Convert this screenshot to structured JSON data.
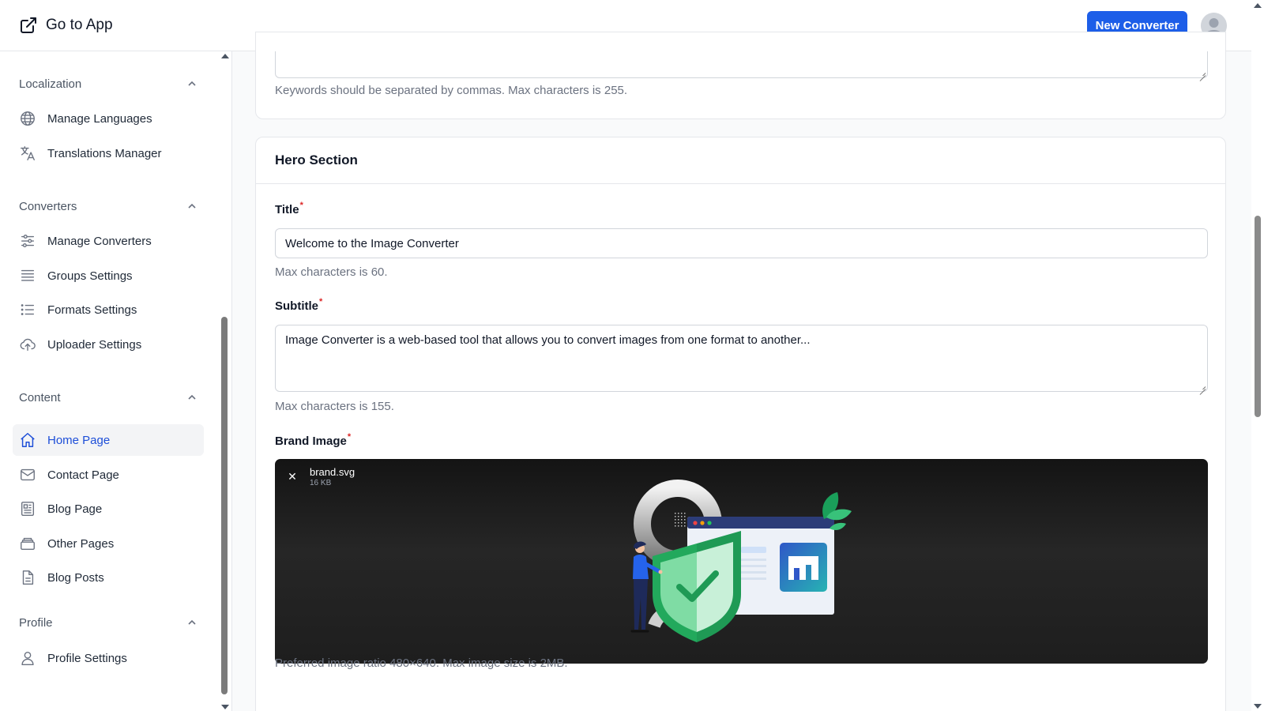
{
  "header": {
    "goto_label": "Go to App",
    "new_button": "New Converter"
  },
  "sidebar": {
    "groups": [
      {
        "title": "Localization",
        "items": [
          "Manage Languages",
          "Translations Manager"
        ]
      },
      {
        "title": "Converters",
        "items": [
          "Manage Converters",
          "Groups Settings",
          "Formats Settings",
          "Uploader Settings"
        ]
      },
      {
        "title": "Content",
        "items": [
          "Home Page",
          "Contact Page",
          "Blog Page",
          "Other Pages",
          "Blog Posts"
        ]
      },
      {
        "title": "Profile",
        "items": [
          "Profile Settings"
        ]
      }
    ],
    "active_item": "Home Page"
  },
  "seo_card": {
    "keywords_help": "Keywords should be separated by commas. Max characters is 255."
  },
  "hero": {
    "title": "Hero Section",
    "title_label": "Title",
    "title_value": "Welcome to the Image Converter",
    "title_help": "Max characters is 60.",
    "subtitle_label": "Subtitle",
    "subtitle_value": "Image Converter is a web-based tool that allows you to convert images from one format to another...",
    "subtitle_help": "Max characters is 155.",
    "brand_label": "Brand Image",
    "required_mark": "*",
    "file_name": "brand.svg",
    "file_size": "16 KB",
    "close_glyph": "✕",
    "brand_help": "Preferred image ratio 480×640. Max image size is 2MB."
  },
  "colors": {
    "primary": "#1d5ee8",
    "active_text": "#1d4ed8",
    "shield_green": "#22a95c",
    "required": "#dc2626"
  },
  "icons": {
    "goto": "external-link-icon",
    "collapse": "chevron-up-icon",
    "close": "close-icon"
  }
}
